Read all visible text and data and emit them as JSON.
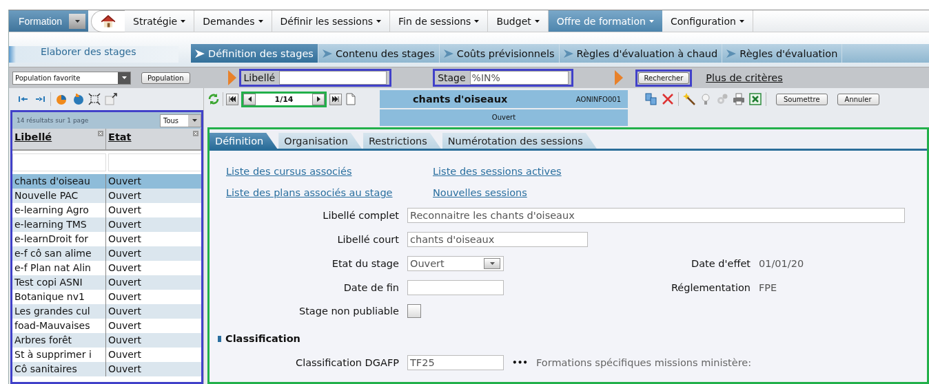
{
  "menu": {
    "app": {
      "label": "Formation",
      "selected": false
    },
    "items": [
      {
        "label": "Stratégie",
        "selected": false
      },
      {
        "label": "Demandes",
        "selected": false
      },
      {
        "label": "Définir les sessions",
        "selected": false
      },
      {
        "label": "Fin de sessions",
        "selected": false
      },
      {
        "label": "Budget",
        "selected": false
      },
      {
        "label": "Offre de formation",
        "selected": true
      },
      {
        "label": "Configuration",
        "selected": false
      }
    ]
  },
  "section": {
    "title": "Elaborer des stages",
    "steps": [
      {
        "label": "Définition des stages",
        "selected": true
      },
      {
        "label": "Contenu des stages",
        "selected": false
      },
      {
        "label": "Coûts prévisionnels",
        "selected": false
      },
      {
        "label": "Règles d'évaluation à chaud",
        "selected": false
      },
      {
        "label": "Règles d'évaluation",
        "selected": false
      }
    ]
  },
  "search": {
    "population_select": "Population favorite",
    "population_button": "Population",
    "fields": [
      {
        "label": "Libellé"
      },
      {
        "label": "Stage",
        "value": "%IN%"
      }
    ],
    "search_button": "Rechercher",
    "more_link": "Plus de critères"
  },
  "list": {
    "summary": "14 résultats sur 1 page",
    "page_size": "Tous",
    "columns": [
      "Libellé",
      "Etat"
    ],
    "rows": [
      {
        "cells": [
          "chants d'oiseau",
          "Ouvert"
        ],
        "selected": true
      },
      {
        "cells": [
          "Nouvelle PAC",
          "Ouvert"
        ],
        "selected": false
      },
      {
        "cells": [
          "e-learning Agro",
          "Ouvert"
        ],
        "selected": false
      },
      {
        "cells": [
          "e-learning TMS",
          "Ouvert"
        ],
        "selected": false
      },
      {
        "cells": [
          "e-learnDroit for",
          "Ouvert"
        ],
        "selected": false
      },
      {
        "cells": [
          "e-f cô san alime",
          "Ouvert"
        ],
        "selected": false
      },
      {
        "cells": [
          "e-f Plan nat Alin",
          "Ouvert"
        ],
        "selected": false
      },
      {
        "cells": [
          "Test copi ASNI",
          "Ouvert"
        ],
        "selected": false
      },
      {
        "cells": [
          "Botanique nv1",
          "Ouvert"
        ],
        "selected": false
      },
      {
        "cells": [
          "Les grandes cul",
          "Ouvert"
        ],
        "selected": false
      },
      {
        "cells": [
          "foad-Mauvaises",
          "Ouvert"
        ],
        "selected": false
      },
      {
        "cells": [
          "Arbres forêt",
          "Ouvert"
        ],
        "selected": false
      },
      {
        "cells": [
          "St à supprimer i",
          "Ouvert"
        ],
        "selected": false
      },
      {
        "cells": [
          "Cô sanitaires",
          "Ouvert"
        ],
        "selected": false
      }
    ]
  },
  "record": {
    "pager": "1/14",
    "title": "chants d'oiseaux",
    "code": "AONINFO001",
    "status": "Ouvert",
    "buttons": [
      "Soumettre",
      "Annuler"
    ],
    "tabs": [
      {
        "label": "Définition",
        "selected": true
      },
      {
        "label": "Organisation",
        "selected": false
      },
      {
        "label": "Restrictions",
        "selected": false
      },
      {
        "label": "Numérotation des sessions",
        "selected": false
      }
    ],
    "links": [
      "Liste des cursus associés",
      "Liste des sessions actives",
      "Liste des plans associés au stage",
      "Nouvelles sessions"
    ],
    "fields": [
      {
        "kind": "text",
        "label": "Libellé complet",
        "value": "Reconnaitre les chants d'oiseaux"
      },
      {
        "kind": "text",
        "label": "Libellé court",
        "value": "chants d'oiseaux"
      },
      {
        "kind": "select",
        "label": "Etat du stage",
        "value": "Ouvert",
        "aside": {
          "label": "Date d'effet",
          "value": "01/01/20"
        }
      },
      {
        "kind": "text",
        "label": "Date de fin",
        "aside": {
          "label": "Réglementation",
          "value": "FPE"
        }
      },
      {
        "kind": "checkbox",
        "label": "Stage non publiable",
        "checked": false
      }
    ],
    "sections": [
      {
        "title": "Classification",
        "fields": [
          {
            "label": "Classification DGAFP",
            "value": "TF25",
            "more": "•••",
            "description": "Formations spécifiques missions ministère:"
          }
        ]
      }
    ]
  }
}
